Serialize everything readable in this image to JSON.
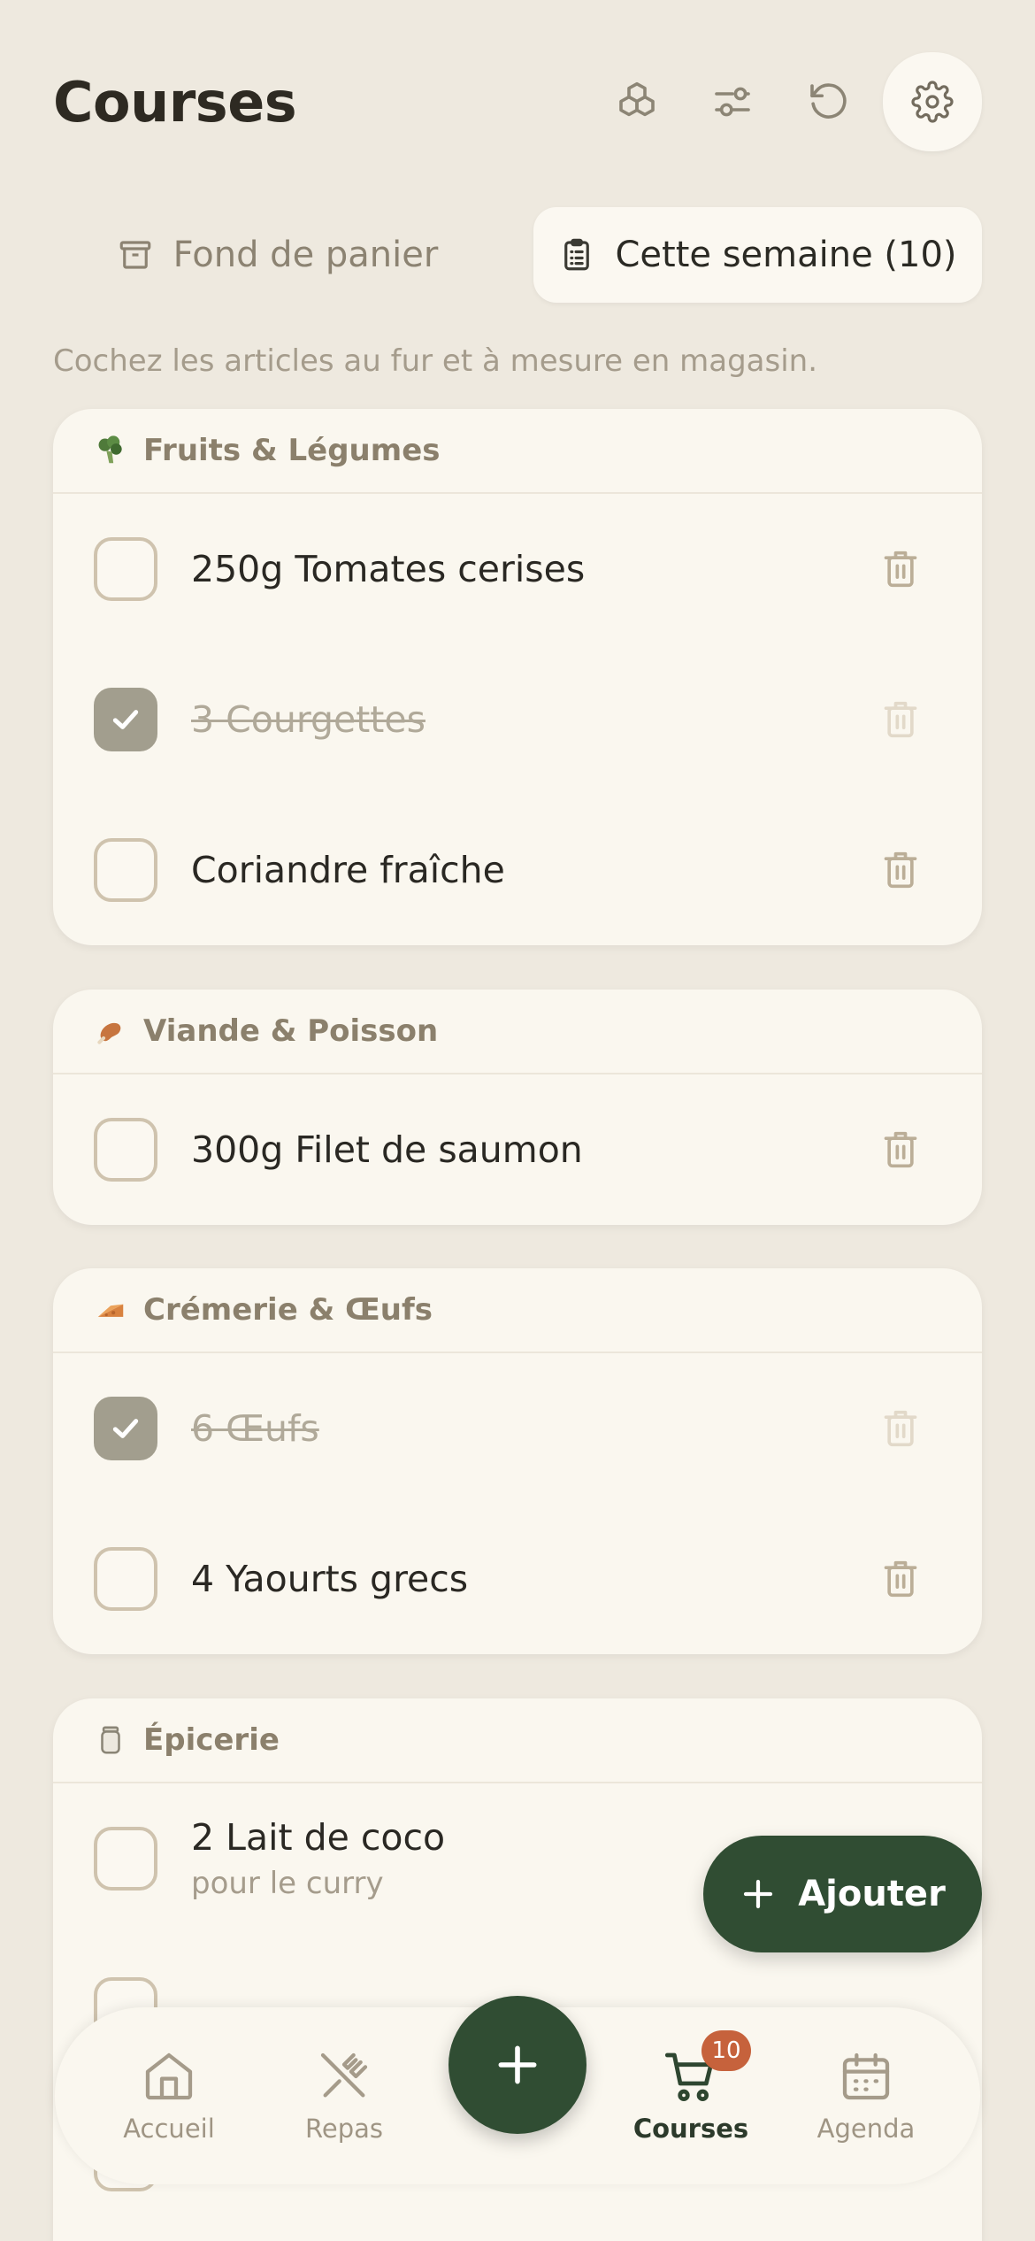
{
  "header": {
    "title": "Courses"
  },
  "tabs": [
    {
      "label": "Fond de panier",
      "active": false
    },
    {
      "label": "Cette semaine (10)",
      "active": true
    }
  ],
  "hint": "Cochez les articles au fur et à mesure en magasin.",
  "sections": [
    {
      "title": "Fruits & Légumes",
      "icon": "broccoli-icon",
      "items": [
        {
          "label": "250g Tomates cerises",
          "checked": false
        },
        {
          "label": "3 Courgettes",
          "checked": true
        },
        {
          "label": "Coriandre fraîche",
          "checked": false
        }
      ]
    },
    {
      "title": "Viande & Poisson",
      "icon": "meat-icon",
      "items": [
        {
          "label": "300g Filet de saumon",
          "checked": false
        }
      ]
    },
    {
      "title": "Crémerie & Œufs",
      "icon": "cheese-icon",
      "items": [
        {
          "label": "6 Œufs",
          "checked": true
        },
        {
          "label": "4 Yaourts grecs",
          "checked": false
        }
      ]
    },
    {
      "title": "Épicerie",
      "icon": "jar-icon",
      "items": [
        {
          "label": "2 Lait de coco",
          "note": "pour le curry",
          "checked": false
        }
      ]
    }
  ],
  "fab": {
    "label": "Ajouter"
  },
  "nav": {
    "items": [
      {
        "label": "Accueil",
        "icon": "home-icon"
      },
      {
        "label": "Repas",
        "icon": "utensils-icon"
      },
      {
        "label": "Courses",
        "icon": "cart-icon",
        "active": true,
        "badge": "10"
      },
      {
        "label": "Agenda",
        "icon": "calendar-icon"
      }
    ]
  },
  "colors": {
    "accent": "#304D33",
    "badge": "#C6623C",
    "background": "#EEE9DF",
    "card": "#FAF7EF"
  }
}
